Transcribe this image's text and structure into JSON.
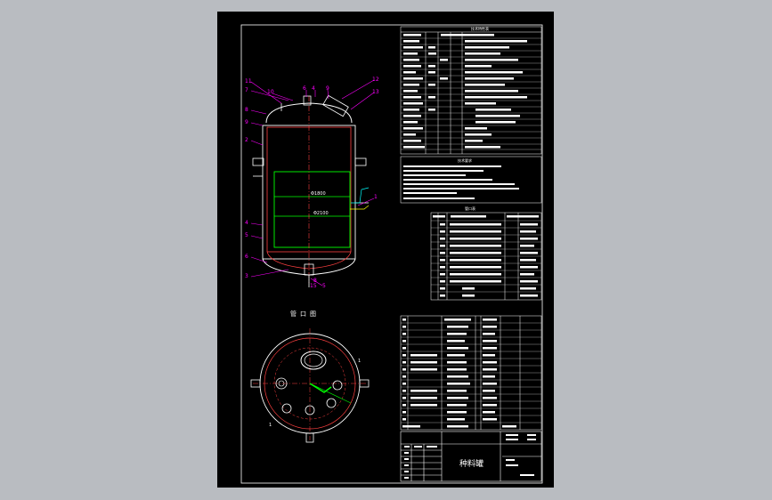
{
  "title_block": {
    "drawing_title": "种料罐"
  },
  "sections": {
    "tech_table_title": "技术特性表",
    "tech_req_title": "技术要求",
    "nozzle_table_title": "管口表",
    "nozzle_view_title": "管口图"
  },
  "leaders": {
    "left": [
      "11",
      "7",
      "8",
      "9",
      "2",
      "4",
      "5",
      "6",
      "3"
    ],
    "top": [
      "10",
      "6",
      "4",
      "9",
      "12",
      "13"
    ],
    "right": [
      "1"
    ],
    "bottom": [
      "15",
      "8",
      "5"
    ]
  },
  "dimensions": {
    "inner_diameter": "Φ1800",
    "outer_diameter": "Φ2100"
  },
  "colors": {
    "line_white": "#ffffff",
    "vessel_green": "#00ff00",
    "annotation_magenta": "#ff00ff",
    "centerline_red": "#ff0000",
    "pipe_yellow": "#ffff00",
    "cyan": "#00ffff"
  }
}
